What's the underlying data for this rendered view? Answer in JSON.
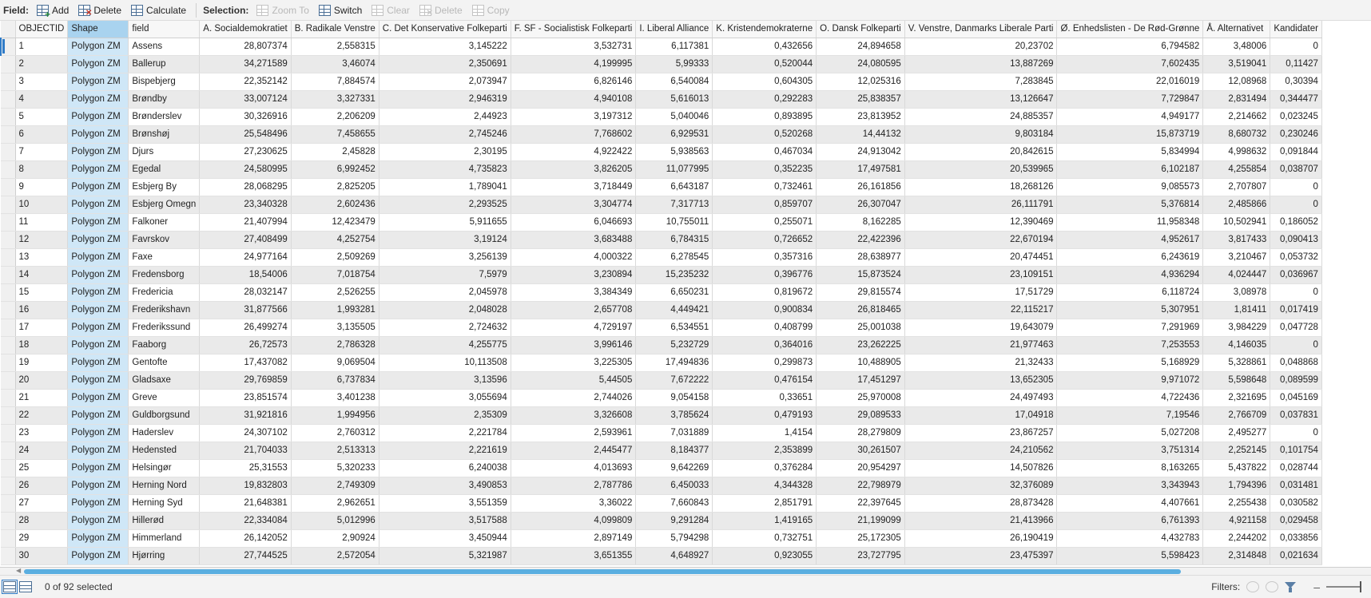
{
  "toolbar": {
    "field_label": "Field:",
    "add_label": "Add",
    "delete_label": "Delete",
    "calculate_label": "Calculate",
    "selection_label": "Selection:",
    "zoom_to_label": "Zoom To",
    "switch_label": "Switch",
    "clear_label": "Clear",
    "sel_delete_label": "Delete",
    "copy_label": "Copy"
  },
  "table": {
    "columns": [
      "OBJECTID",
      "Shape",
      "field",
      "A. Socialdemokratiet",
      "B. Radikale Venstre",
      "C. Det Konservative Folkeparti",
      "F. SF - Socialistisk Folkeparti",
      "I. Liberal Alliance",
      "K. Kristendemokraterne",
      "O. Dansk Folkeparti",
      "V. Venstre, Danmarks Liberale Parti",
      "Ø. Enhedslisten - De Rød-Grønne",
      "Å. Alternativet",
      "Kandidater"
    ],
    "rows": [
      [
        "1",
        "Polygon ZM",
        "Assens",
        "28,807374",
        "2,558315",
        "3,145222",
        "3,532731",
        "6,117381",
        "0,432656",
        "24,894658",
        "20,23702",
        "6,794582",
        "3,48006",
        "0"
      ],
      [
        "2",
        "Polygon ZM",
        "Ballerup",
        "34,271589",
        "3,46074",
        "2,350691",
        "4,199995",
        "5,99333",
        "0,520044",
        "24,080595",
        "13,887269",
        "7,602435",
        "3,519041",
        "0,11427"
      ],
      [
        "3",
        "Polygon ZM",
        "Bispebjerg",
        "22,352142",
        "7,884574",
        "2,073947",
        "6,826146",
        "6,540084",
        "0,604305",
        "12,025316",
        "7,283845",
        "22,016019",
        "12,08968",
        "0,30394"
      ],
      [
        "4",
        "Polygon ZM",
        "Brøndby",
        "33,007124",
        "3,327331",
        "2,946319",
        "4,940108",
        "5,616013",
        "0,292283",
        "25,838357",
        "13,126647",
        "7,729847",
        "2,831494",
        "0,344477"
      ],
      [
        "5",
        "Polygon ZM",
        "Brønderslev",
        "30,326916",
        "2,206209",
        "2,44923",
        "3,197312",
        "5,040046",
        "0,893895",
        "23,813952",
        "24,885357",
        "4,949177",
        "2,214662",
        "0,023245"
      ],
      [
        "6",
        "Polygon ZM",
        "Brønshøj",
        "25,548496",
        "7,458655",
        "2,745246",
        "7,768602",
        "6,929531",
        "0,520268",
        "14,44132",
        "9,803184",
        "15,873719",
        "8,680732",
        "0,230246"
      ],
      [
        "7",
        "Polygon ZM",
        "Djurs",
        "27,230625",
        "2,45828",
        "2,30195",
        "4,922422",
        "5,938563",
        "0,467034",
        "24,913042",
        "20,842615",
        "5,834994",
        "4,998632",
        "0,091844"
      ],
      [
        "8",
        "Polygon ZM",
        "Egedal",
        "24,580995",
        "6,992452",
        "4,735823",
        "3,826205",
        "11,077995",
        "0,352235",
        "17,497581",
        "20,539965",
        "6,102187",
        "4,255854",
        "0,038707"
      ],
      [
        "9",
        "Polygon ZM",
        "Esbjerg By",
        "28,068295",
        "2,825205",
        "1,789041",
        "3,718449",
        "6,643187",
        "0,732461",
        "26,161856",
        "18,268126",
        "9,085573",
        "2,707807",
        "0"
      ],
      [
        "10",
        "Polygon ZM",
        "Esbjerg Omegn",
        "23,340328",
        "2,602436",
        "2,293525",
        "3,304774",
        "7,317713",
        "0,859707",
        "26,307047",
        "26,111791",
        "5,376814",
        "2,485866",
        "0"
      ],
      [
        "11",
        "Polygon ZM",
        "Falkoner",
        "21,407994",
        "12,423479",
        "5,911655",
        "6,046693",
        "10,755011",
        "0,255071",
        "8,162285",
        "12,390469",
        "11,958348",
        "10,502941",
        "0,186052"
      ],
      [
        "12",
        "Polygon ZM",
        "Favrskov",
        "27,408499",
        "4,252754",
        "3,19124",
        "3,683488",
        "6,784315",
        "0,726652",
        "22,422396",
        "22,670194",
        "4,952617",
        "3,817433",
        "0,090413"
      ],
      [
        "13",
        "Polygon ZM",
        "Faxe",
        "24,977164",
        "2,509269",
        "3,256139",
        "4,000322",
        "6,278545",
        "0,357316",
        "28,638977",
        "20,474451",
        "6,243619",
        "3,210467",
        "0,053732"
      ],
      [
        "14",
        "Polygon ZM",
        "Fredensborg",
        "18,54006",
        "7,018754",
        "7,5979",
        "3,230894",
        "15,235232",
        "0,396776",
        "15,873524",
        "23,109151",
        "4,936294",
        "4,024447",
        "0,036967"
      ],
      [
        "15",
        "Polygon ZM",
        "Fredericia",
        "28,032147",
        "2,526255",
        "2,045978",
        "3,384349",
        "6,650231",
        "0,819672",
        "29,815574",
        "17,51729",
        "6,118724",
        "3,08978",
        "0"
      ],
      [
        "16",
        "Polygon ZM",
        "Frederikshavn",
        "31,877566",
        "1,993281",
        "2,048028",
        "2,657708",
        "4,449421",
        "0,900834",
        "26,818465",
        "22,115217",
        "5,307951",
        "1,81411",
        "0,017419"
      ],
      [
        "17",
        "Polygon ZM",
        "Frederikssund",
        "26,499274",
        "3,135505",
        "2,724632",
        "4,729197",
        "6,534551",
        "0,408799",
        "25,001038",
        "19,643079",
        "7,291969",
        "3,984229",
        "0,047728"
      ],
      [
        "18",
        "Polygon ZM",
        "Faaborg",
        "26,72573",
        "2,786328",
        "4,255775",
        "3,996146",
        "5,232729",
        "0,364016",
        "23,262225",
        "21,977463",
        "7,253553",
        "4,146035",
        "0"
      ],
      [
        "19",
        "Polygon ZM",
        "Gentofte",
        "17,437082",
        "9,069504",
        "10,113508",
        "3,225305",
        "17,494836",
        "0,299873",
        "10,488905",
        "21,32433",
        "5,168929",
        "5,328861",
        "0,048868"
      ],
      [
        "20",
        "Polygon ZM",
        "Gladsaxe",
        "29,769859",
        "6,737834",
        "3,13596",
        "5,44505",
        "7,672222",
        "0,476154",
        "17,451297",
        "13,652305",
        "9,971072",
        "5,598648",
        "0,089599"
      ],
      [
        "21",
        "Polygon ZM",
        "Greve",
        "23,851574",
        "3,401238",
        "3,055694",
        "2,744026",
        "9,054158",
        "0,33651",
        "25,970008",
        "24,497493",
        "4,722436",
        "2,321695",
        "0,045169"
      ],
      [
        "22",
        "Polygon ZM",
        "Guldborgsund",
        "31,921816",
        "1,994956",
        "2,35309",
        "3,326608",
        "3,785624",
        "0,479193",
        "29,089533",
        "17,04918",
        "7,19546",
        "2,766709",
        "0,037831"
      ],
      [
        "23",
        "Polygon ZM",
        "Haderslev",
        "24,307102",
        "2,760312",
        "2,221784",
        "2,593961",
        "7,031889",
        "1,4154",
        "28,279809",
        "23,867257",
        "5,027208",
        "2,495277",
        "0"
      ],
      [
        "24",
        "Polygon ZM",
        "Hedensted",
        "21,704033",
        "2,513313",
        "2,221619",
        "2,445477",
        "8,184377",
        "2,353899",
        "30,261507",
        "24,210562",
        "3,751314",
        "2,252145",
        "0,101754"
      ],
      [
        "25",
        "Polygon ZM",
        "Helsingør",
        "25,31553",
        "5,320233",
        "6,240038",
        "4,013693",
        "9,642269",
        "0,376284",
        "20,954297",
        "14,507826",
        "8,163265",
        "5,437822",
        "0,028744"
      ],
      [
        "26",
        "Polygon ZM",
        "Herning Nord",
        "19,832803",
        "2,749309",
        "3,490853",
        "2,787786",
        "6,450033",
        "4,344328",
        "22,798979",
        "32,376089",
        "3,343943",
        "1,794396",
        "0,031481"
      ],
      [
        "27",
        "Polygon ZM",
        "Herning Syd",
        "21,648381",
        "2,962651",
        "3,551359",
        "3,36022",
        "7,660843",
        "2,851791",
        "22,397645",
        "28,873428",
        "4,407661",
        "2,255438",
        "0,030582"
      ],
      [
        "28",
        "Polygon ZM",
        "Hillerød",
        "22,334084",
        "5,012996",
        "3,517588",
        "4,099809",
        "9,291284",
        "1,419165",
        "21,199099",
        "21,413966",
        "6,761393",
        "4,921158",
        "0,029458"
      ],
      [
        "29",
        "Polygon ZM",
        "Himmerland",
        "26,142052",
        "2,90924",
        "3,450944",
        "2,897149",
        "5,794298",
        "0,732751",
        "25,172305",
        "26,190419",
        "4,432783",
        "2,244202",
        "0,033856"
      ],
      [
        "30",
        "Polygon ZM",
        "Hjørring",
        "27,744525",
        "2,572054",
        "5,321987",
        "3,651355",
        "4,648927",
        "0,923055",
        "23,727795",
        "23,475397",
        "5,598423",
        "2,314848",
        "0,021634"
      ]
    ]
  },
  "statusbar": {
    "selected_text": "0 of 92 selected",
    "filters_label": "Filters:",
    "zoom_minus": "–"
  }
}
